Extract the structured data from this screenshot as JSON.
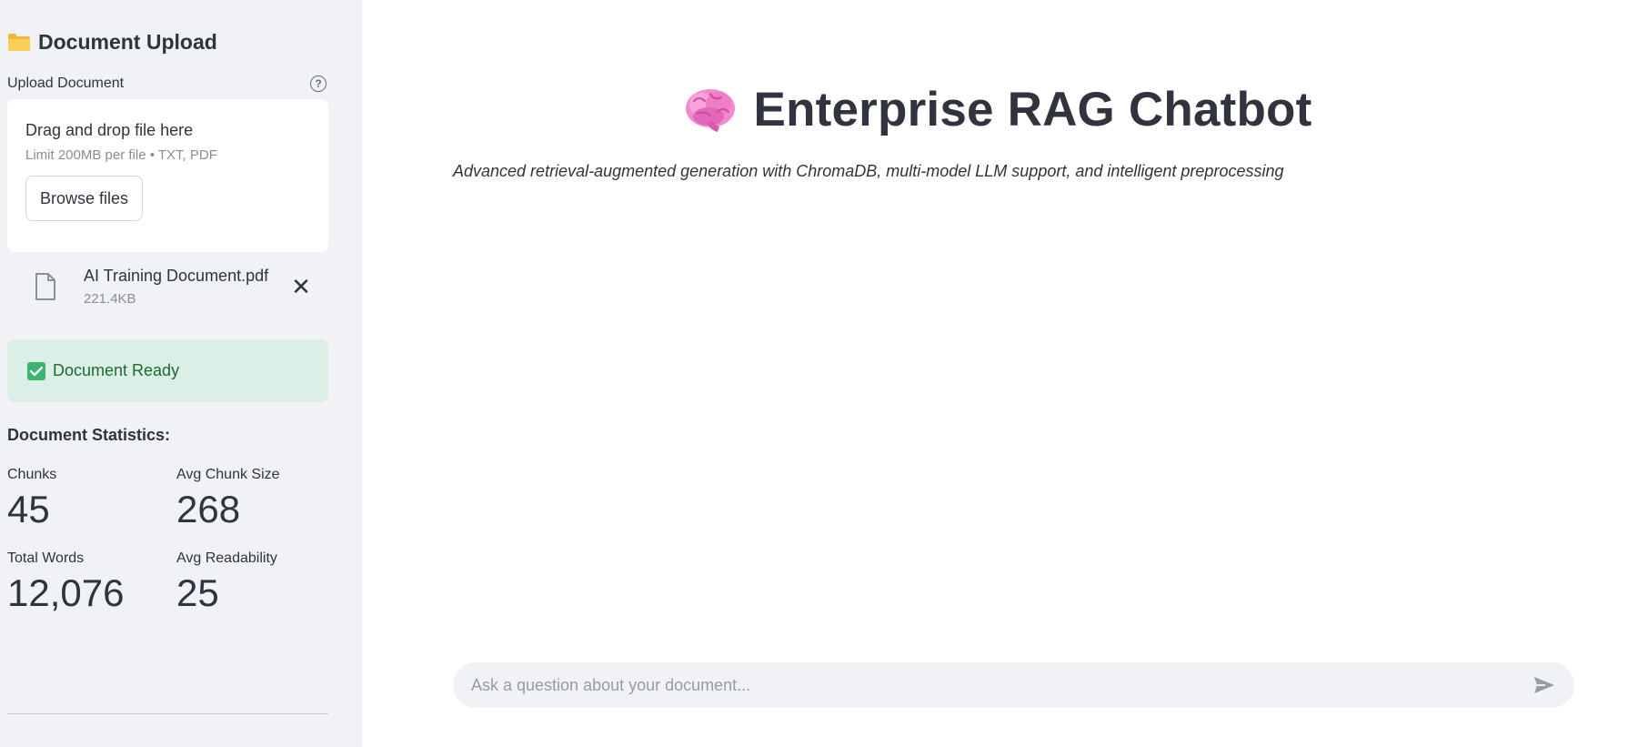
{
  "sidebar": {
    "title": "Document Upload",
    "upload_label": "Upload Document",
    "help_glyph": "?",
    "dropzone": {
      "title": "Drag and drop file here",
      "limit": "Limit 200MB per file • TXT, PDF",
      "browse_label": "Browse files"
    },
    "file": {
      "name": "AI Training Document.pdf",
      "size": "221.4KB",
      "remove_glyph": "✕"
    },
    "status": {
      "text": "Document Ready",
      "color": "#1b6b34",
      "bg": "#dcefe6"
    },
    "stats": {
      "title": "Document Statistics:",
      "items": [
        {
          "label": "Chunks",
          "value": "45"
        },
        {
          "label": "Avg Chunk Size",
          "value": "268"
        },
        {
          "label": "Total Words",
          "value": "12,076"
        },
        {
          "label": "Avg Readability",
          "value": "25"
        }
      ]
    }
  },
  "main": {
    "title": "Enterprise RAG Chatbot",
    "subtitle": "Advanced retrieval-augmented generation with ChromaDB, multi-model LLM support, and intelligent preprocessing",
    "chat": {
      "placeholder": "Ask a question about your document..."
    }
  },
  "icons": {
    "folder": "folder-icon",
    "help": "help-icon",
    "file": "file-icon",
    "remove": "close-icon",
    "check": "checkbox-check-icon",
    "brain": "brain-icon",
    "send": "send-icon"
  },
  "colors": {
    "sidebar_bg": "#f0f2f6",
    "text": "#31333f",
    "muted": "#8a8d98"
  }
}
